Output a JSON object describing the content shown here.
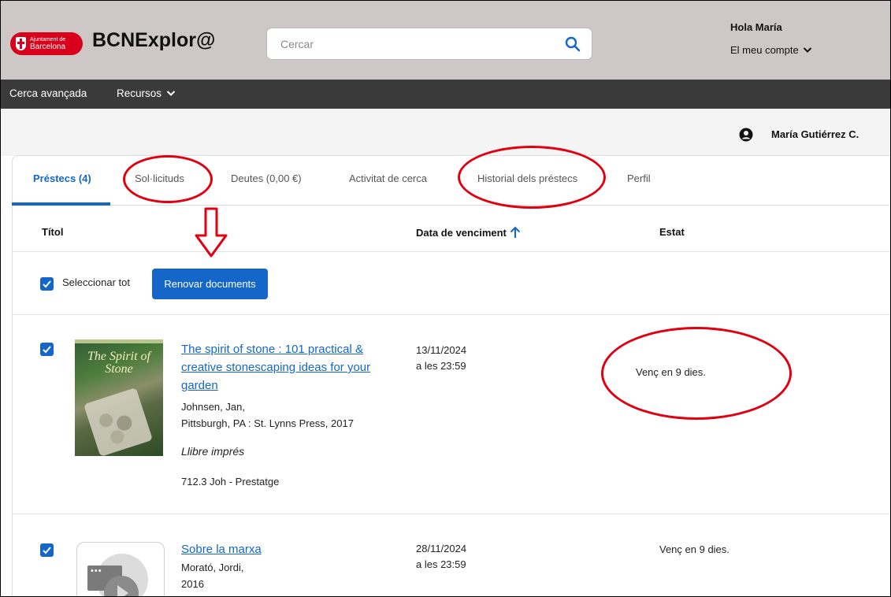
{
  "header": {
    "logo_line1": "Ajuntament de",
    "logo_line2": "Barcelona",
    "brand": "BCNExplor@",
    "search_placeholder": "Cercar",
    "greeting": "Hola María",
    "account_label": "El meu compte"
  },
  "nav": {
    "advanced_search": "Cerca avançada",
    "resources": "Recursos"
  },
  "user": {
    "name": "María Gutiérrez C."
  },
  "tabs": [
    {
      "label": "Préstecs (4)"
    },
    {
      "label": "Sol·licituds"
    },
    {
      "label": "Deutes (0,00 €)"
    },
    {
      "label": "Activitat de cerca"
    },
    {
      "label": "Historial dels préstecs"
    },
    {
      "label": "Perfil"
    }
  ],
  "columns": {
    "title": "Títol",
    "due_date": "Data de venciment",
    "status": "Estat"
  },
  "actions": {
    "select_all": "Seleccionar tot",
    "renew": "Renovar documents"
  },
  "loans": [
    {
      "cover_text": "The Spirit of Stone",
      "title": "The spirit of stone : 101 practical & creative stonescaping ideas for your garden",
      "author": "Johnsen, Jan,",
      "publication": "Pittsburgh, PA : St. Lynns Press, 2017",
      "format": "Llibre imprés",
      "call_number": "712.3 Joh - Prestatge",
      "due_date": "13/11/2024",
      "due_time": "a les 23:59",
      "status": "Venç en 9 dies."
    },
    {
      "title": "Sobre la marxa",
      "author": "Morató, Jordi,",
      "publication": "2016",
      "due_date": "28/11/2024",
      "due_time": "a les 23:59",
      "status": "Venç en 9 dies."
    }
  ],
  "colors": {
    "accent": "#1466c9",
    "header_bg": "#cdc7c8",
    "nav_bg": "#3a3a3a",
    "logo_red": "#d9001b",
    "annotation_red": "#e00010"
  }
}
